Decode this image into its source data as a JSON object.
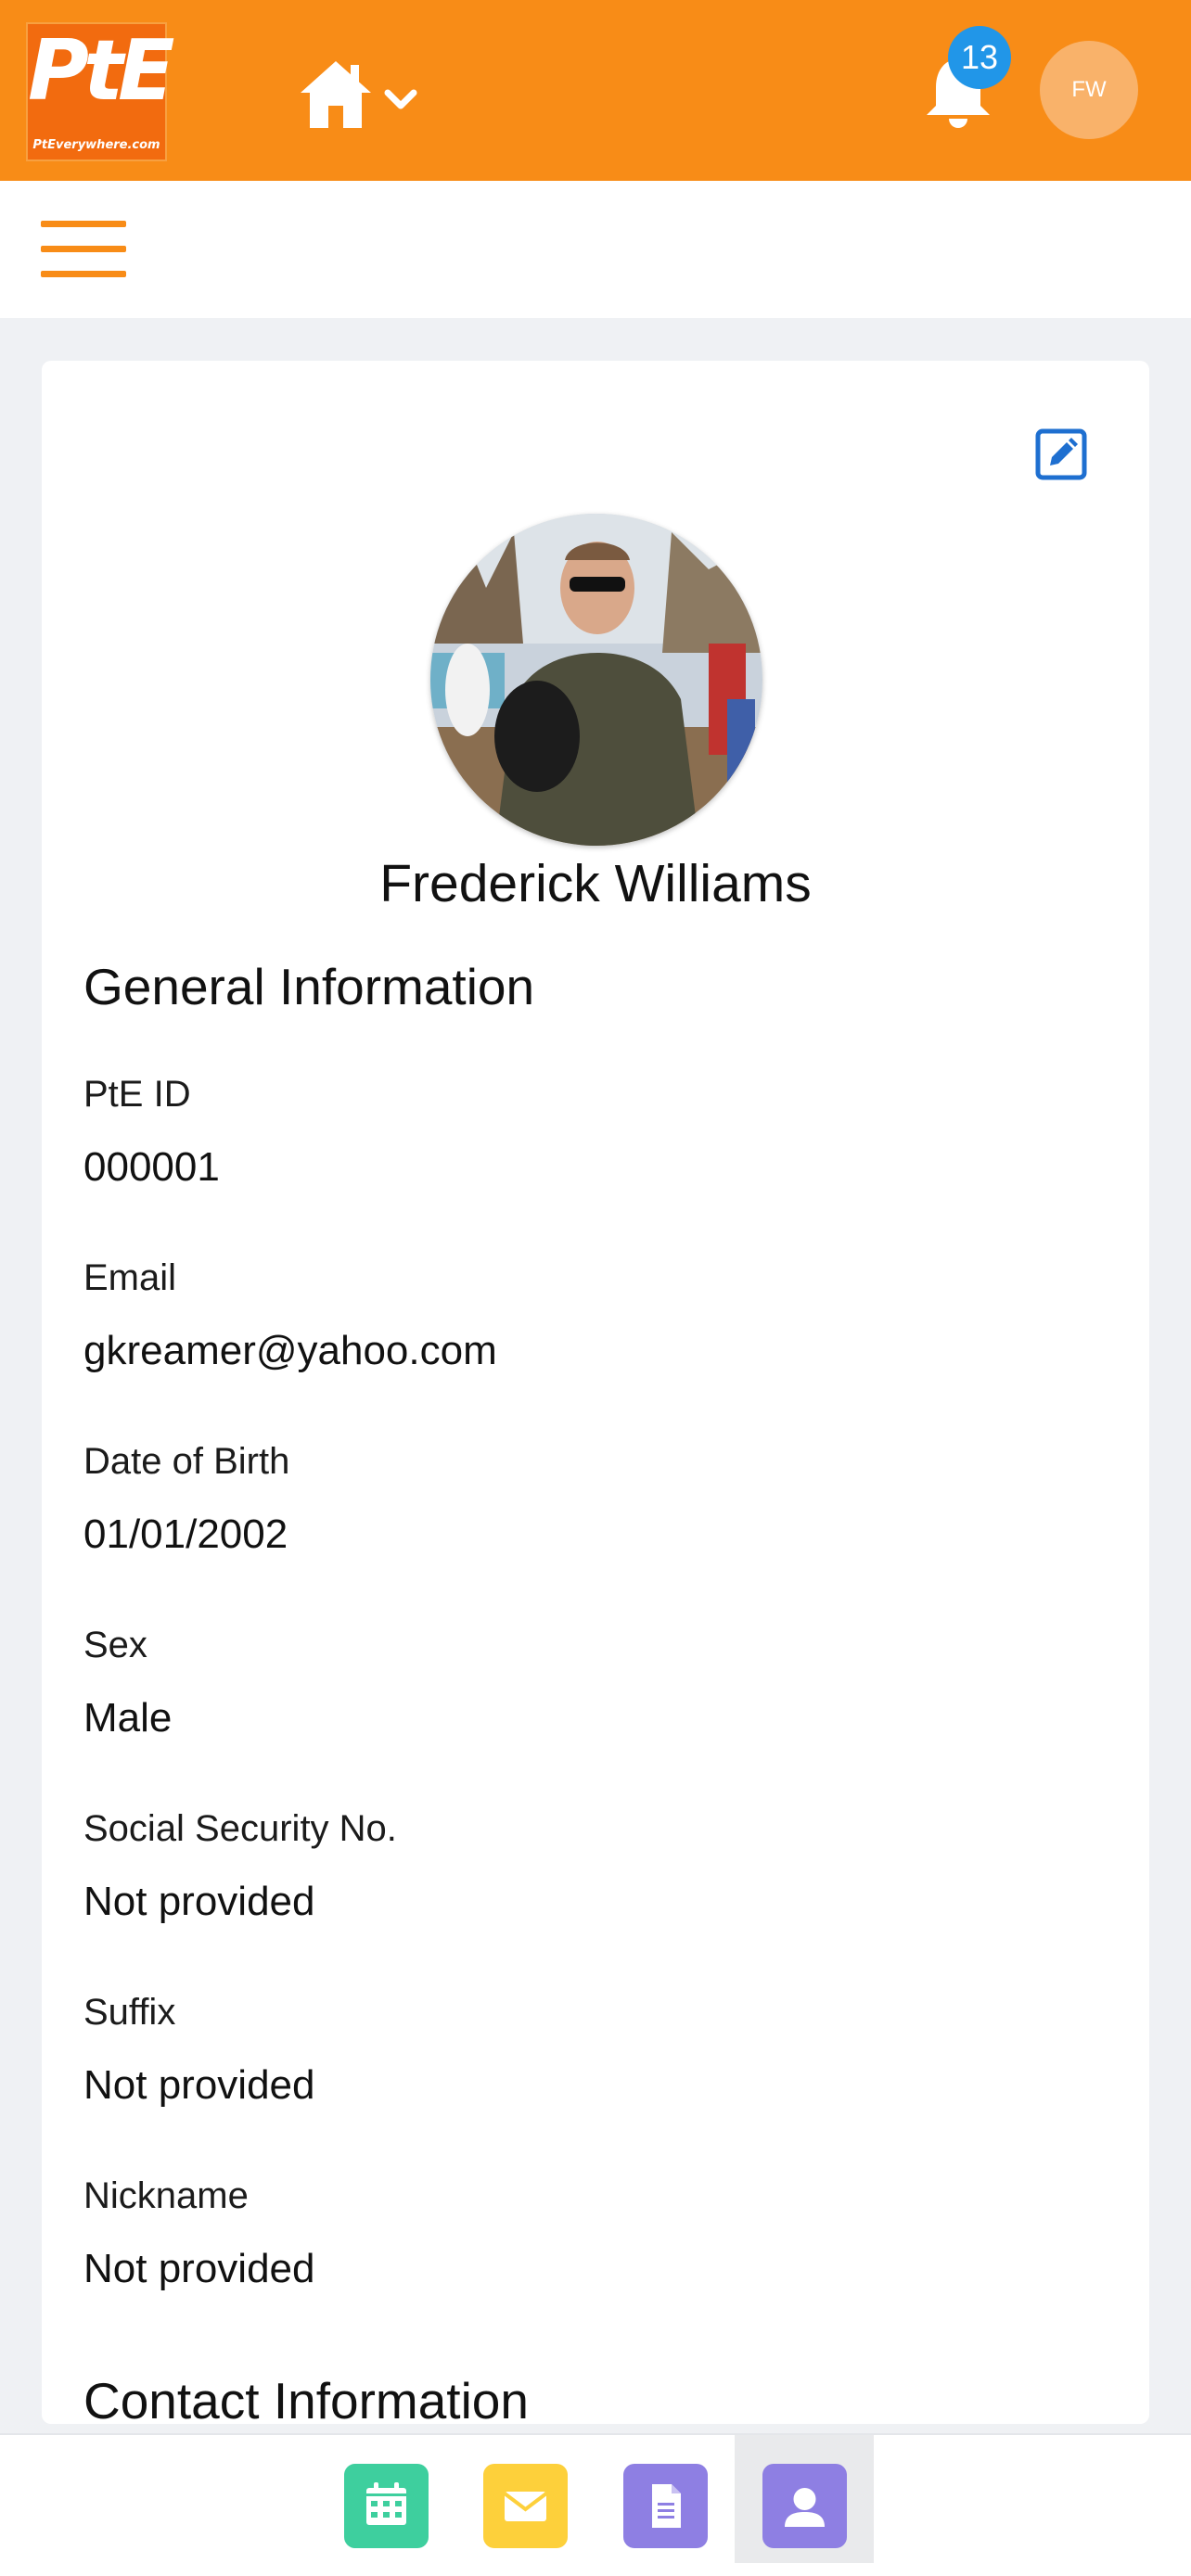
{
  "header": {
    "logo": {
      "mark": "PtE",
      "tagline": "PtEverywhere.com"
    },
    "home_icon": "home-icon",
    "notifications": {
      "icon": "bell-icon",
      "count": "13"
    },
    "user_initials": "FW",
    "colors": {
      "brand": "#f88c17",
      "badge": "#2196e8",
      "avatar": "#f9b26a"
    }
  },
  "subheader": {
    "menu_icon": "hamburger-menu-icon"
  },
  "profile": {
    "edit_icon": "edit-icon",
    "name": "Frederick Williams",
    "general_title": "General Information",
    "fields": [
      {
        "label": "PtE ID",
        "value": "000001"
      },
      {
        "label": "Email",
        "value": "gkreamer@yahoo.com"
      },
      {
        "label": "Date of Birth",
        "value": "01/01/2002"
      },
      {
        "label": "Sex",
        "value": "Male"
      },
      {
        "label": "Social Security No.",
        "value": "Not provided"
      },
      {
        "label": "Suffix",
        "value": "Not provided"
      },
      {
        "label": "Nickname",
        "value": "Not provided"
      }
    ],
    "contact_title": "Contact Information"
  },
  "bottom_nav": {
    "tabs": [
      {
        "icon": "calendar-icon",
        "color": "#3ecf9e"
      },
      {
        "icon": "envelope-icon",
        "color": "#fdd03b"
      },
      {
        "icon": "document-icon",
        "color": "#8e7fe3"
      },
      {
        "icon": "user-icon",
        "color": "#8e7fe3",
        "active": true
      }
    ]
  }
}
